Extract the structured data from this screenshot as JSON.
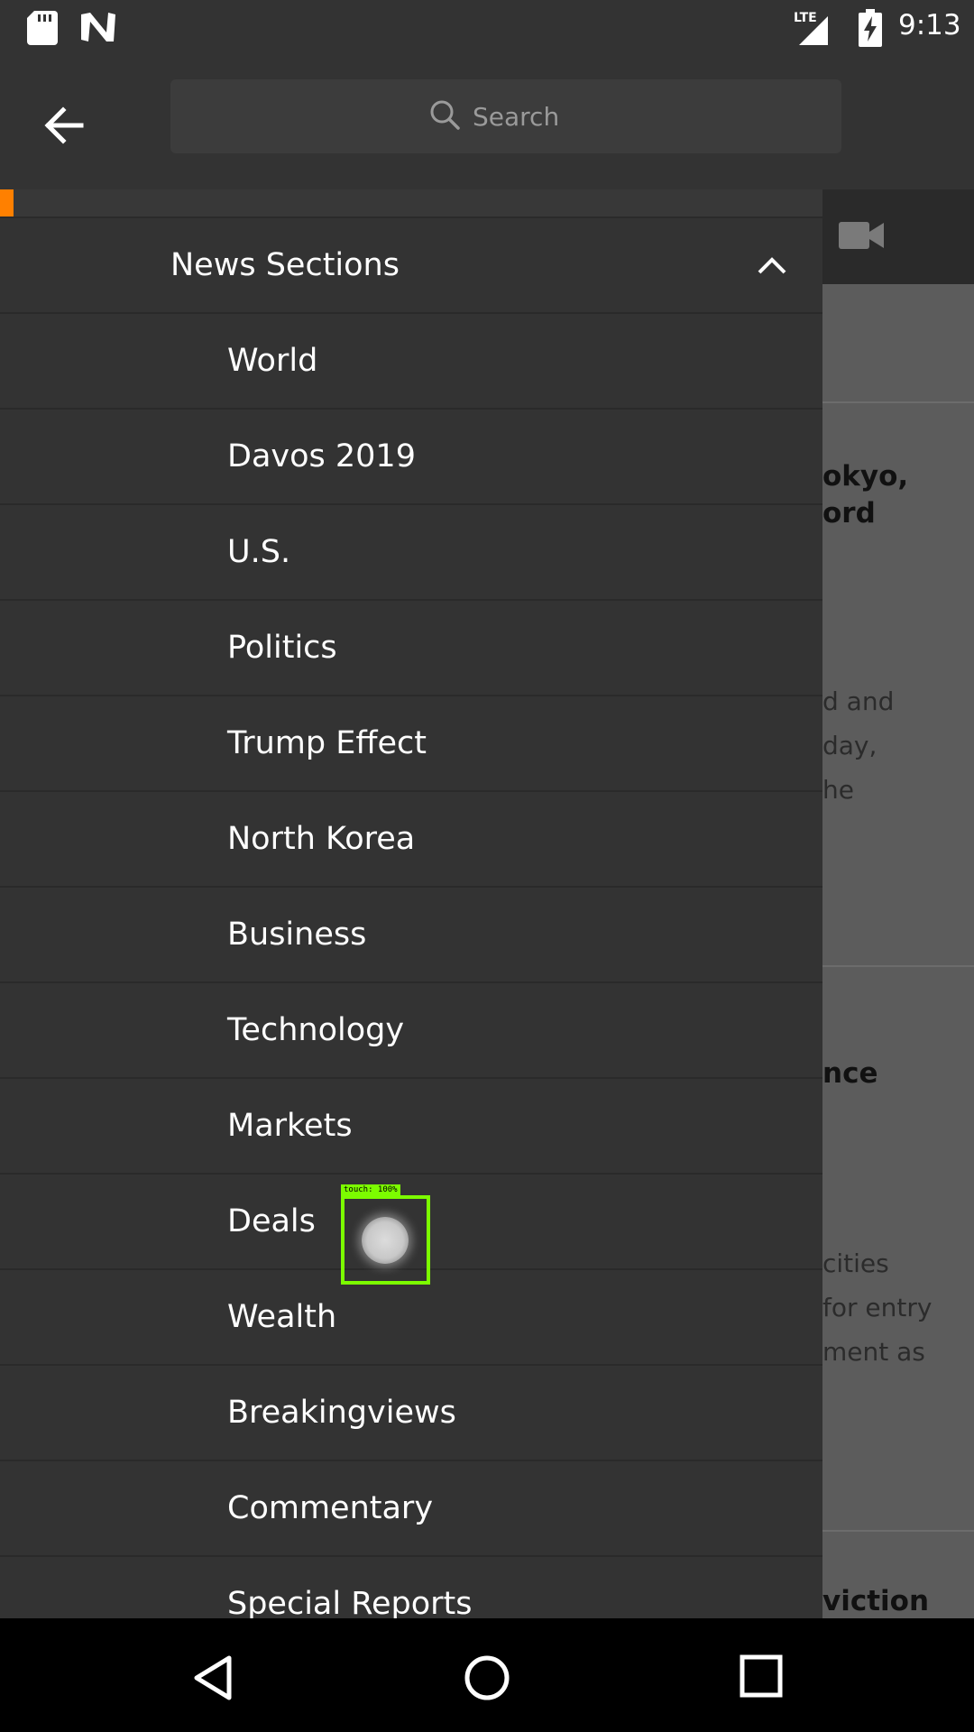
{
  "status_bar": {
    "network": "LTE",
    "time": "9:13"
  },
  "search": {
    "placeholder": "Search"
  },
  "drawer": {
    "section_title": "News Sections",
    "items": [
      {
        "label": "World"
      },
      {
        "label": "Davos 2019"
      },
      {
        "label": "U.S."
      },
      {
        "label": "Politics"
      },
      {
        "label": "Trump Effect"
      },
      {
        "label": "North Korea"
      },
      {
        "label": "Business"
      },
      {
        "label": "Technology"
      },
      {
        "label": "Markets"
      },
      {
        "label": "Deals"
      },
      {
        "label": "Wealth"
      },
      {
        "label": "Breakingviews"
      },
      {
        "label": "Commentary"
      },
      {
        "label": "Special Reports"
      }
    ]
  },
  "background": {
    "headline_1_line_1": "okyo,",
    "headline_1_line_2": "ord",
    "body_1_line_1": "d and",
    "body_1_line_2": "day,",
    "body_1_line_3": "he",
    "headline_2": "nce",
    "body_2_line_1": "cities",
    "body_2_line_2": "for entry",
    "body_2_line_3": "ment as",
    "headline_3": "viction"
  },
  "touch_indicator": {
    "label": "touch: 100%"
  },
  "colors": {
    "accent": "#ff8000",
    "drawer_bg": "#333333",
    "touch": "#7cfc00"
  }
}
